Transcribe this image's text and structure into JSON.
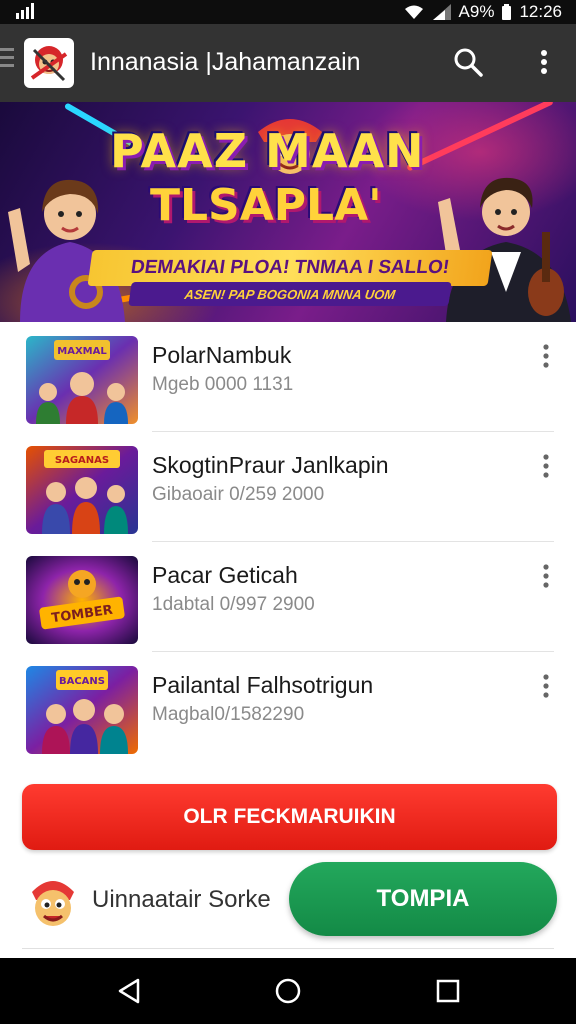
{
  "status_bar": {
    "battery": "A9%",
    "time": "12:26",
    "icons": [
      "signal-bars-icon",
      "wifi-icon",
      "cell-signal-icon"
    ]
  },
  "app_bar": {
    "title": "Innanasia |Jahamanzain",
    "icons": [
      "menu-icon",
      "search-icon",
      "more-vert-icon"
    ]
  },
  "banner": {
    "headline_1": "PAAZ  MAAN",
    "headline_2": "TLSAPLA'",
    "ribbon": "DEMAKIAI PLOA! TNMAA I SALLO!",
    "subline": "ASEN! PAP BOGONIA MNNA UOM"
  },
  "games": [
    {
      "title": "PolarNambuk",
      "meta": "Mgeb 0000 1131",
      "thumb_label": "MAXMAL"
    },
    {
      "title": "SkogtinPraur Janlkapin",
      "meta": "Gibaoair 0/259 2000",
      "thumb_label": "SAGANAS"
    },
    {
      "title": "Pacar Geticah",
      "meta": "1dabtal 0/997 2900",
      "thumb_label": "TOMBER"
    },
    {
      "title": "Pailantal Falhsotrigun",
      "meta": "Magbal0/1582290",
      "thumb_label": "BACANS"
    }
  ],
  "cta": {
    "primary_label": "OLR FECKMARUIKIN",
    "secondary_text": "Uinnaatair Sorke",
    "green_label": "TOMPIA"
  },
  "nav": {
    "icons": [
      "back-icon",
      "home-icon",
      "recents-icon"
    ]
  },
  "colors": {
    "app_bar": "#333333",
    "cta_red": "#ee2a20",
    "cta_green": "#1b9a52",
    "banner_gold": "#ffe14a"
  }
}
